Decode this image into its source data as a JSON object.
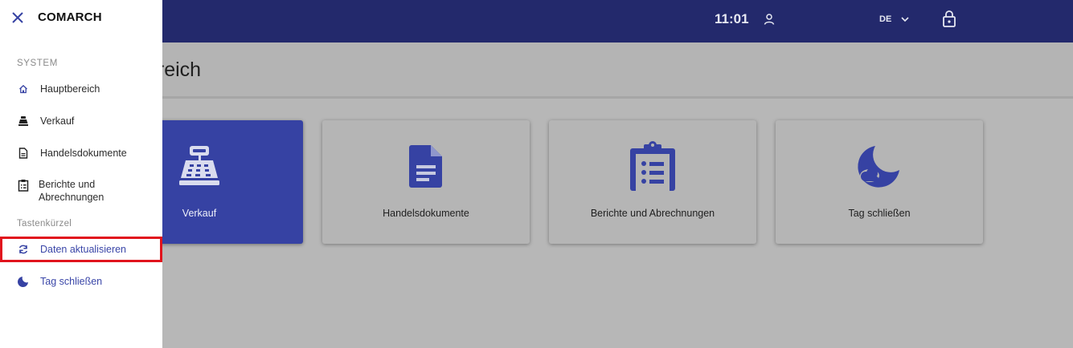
{
  "header": {
    "time": "11:01",
    "language": "DE",
    "icons": [
      "user-icon",
      "chevron-down-icon",
      "lock-icon"
    ]
  },
  "main": {
    "page_title": "ereich",
    "tiles": [
      {
        "label": "Verkauf",
        "icon": "cash-register-icon",
        "active": true
      },
      {
        "label": "Handelsdokumente",
        "icon": "document-icon",
        "active": false
      },
      {
        "label": "Berichte und Abrechnungen",
        "icon": "clipboard-list-icon",
        "active": false
      },
      {
        "label": "Tag schließen",
        "icon": "moon-cloud-icon",
        "active": false
      }
    ]
  },
  "drawer": {
    "brand": "COMARCH",
    "sections": {
      "system": "SYSTEM",
      "shortcuts": "Tastenkürzel"
    },
    "system_items": [
      {
        "label": "Hauptbereich",
        "icon": "home-icon"
      },
      {
        "label": "Verkauf",
        "icon": "cash-register-icon"
      },
      {
        "label": "Handelsdokumente",
        "icon": "document-icon"
      },
      {
        "label": "Berichte und\nAbrechnungen",
        "icon": "clipboard-list-icon"
      }
    ],
    "shortcut_items": [
      {
        "label": "Daten aktualisieren",
        "icon": "refresh-icon",
        "highlighted": true
      },
      {
        "label": "Tag schließen",
        "icon": "moon-cloud-icon",
        "highlighted": false
      }
    ]
  },
  "colors": {
    "header_bg": "#23296c",
    "accent": "#3642a3",
    "highlight_border": "#e1141d"
  }
}
